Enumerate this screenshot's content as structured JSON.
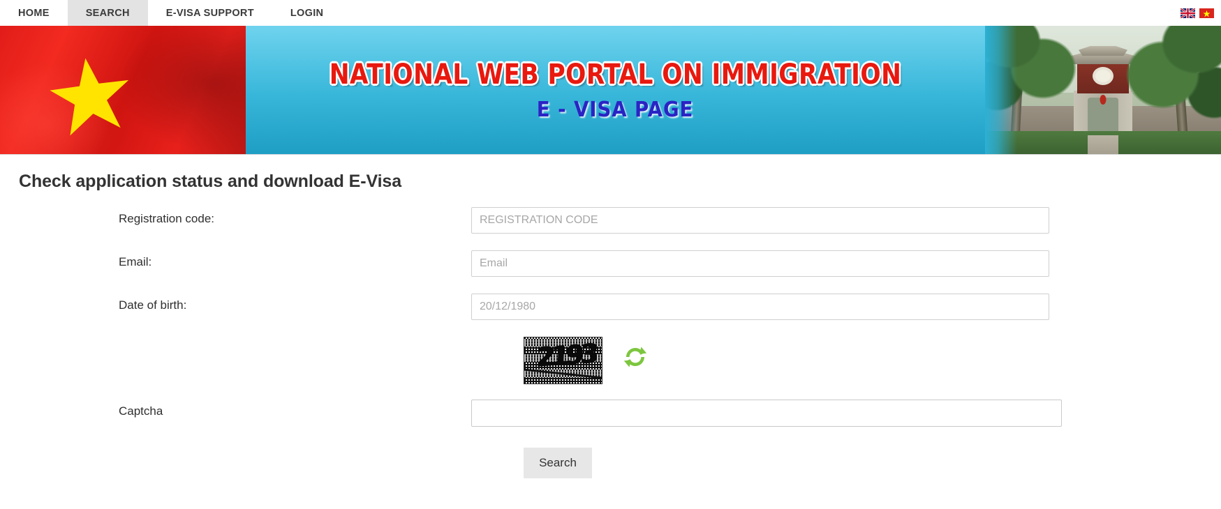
{
  "nav": {
    "items": [
      {
        "label": "HOME",
        "active": false
      },
      {
        "label": "SEARCH",
        "active": true
      },
      {
        "label": "E-VISA SUPPORT",
        "active": false
      },
      {
        "label": "LOGIN",
        "active": false
      }
    ],
    "languages": [
      {
        "name": "english-flag",
        "title": "English"
      },
      {
        "name": "vietnamese-flag",
        "title": "Tiếng Việt"
      }
    ]
  },
  "banner": {
    "title_line1": "NATIONAL WEB PORTAL ON IMMIGRATION",
    "title_line2": "E - VISA PAGE",
    "title_color_line1": "#e8190f",
    "title_color_line2": "#2a24c4",
    "background_color": "#37b6d9"
  },
  "page": {
    "title": "Check application status and download E-Visa"
  },
  "form": {
    "fields": [
      {
        "label": "Registration code:",
        "placeholder": "REGISTRATION CODE",
        "value": ""
      },
      {
        "label": "Email:",
        "placeholder": "Email",
        "value": ""
      },
      {
        "label": "Date of birth:",
        "placeholder": "20/12/1980",
        "value": ""
      }
    ],
    "captcha": {
      "image_text": "2193",
      "refresh_icon": "refresh-icon",
      "refresh_color": "#7dc63f",
      "label": "Captcha",
      "placeholder": "",
      "value": ""
    },
    "submit_label": "Search"
  }
}
